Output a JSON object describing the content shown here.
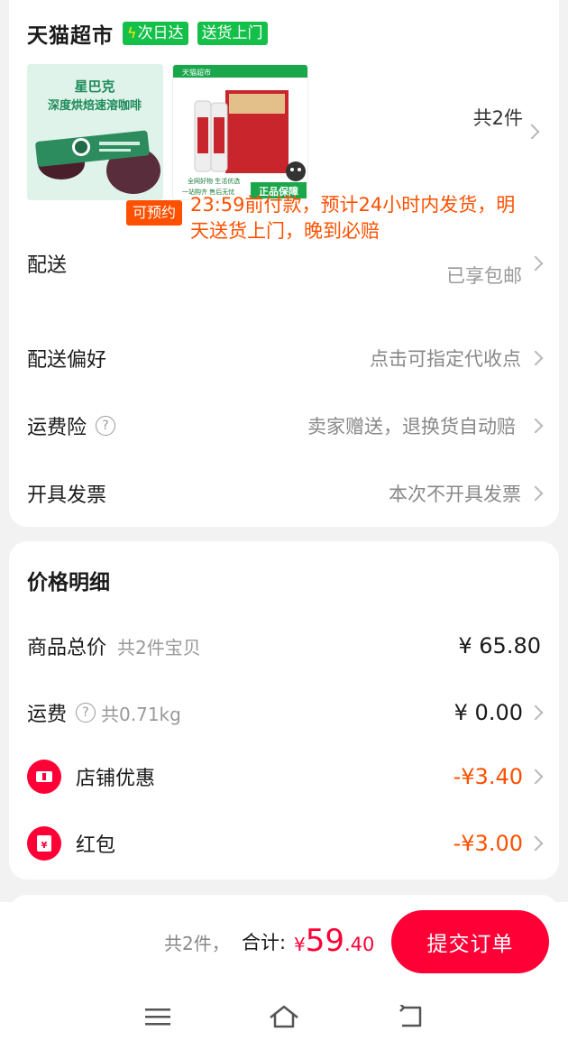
{
  "store": {
    "name": "天猫超市",
    "tag_next_day": "次日达",
    "tag_delivery": "送货上门"
  },
  "products": {
    "item1": {
      "line1": "星巴克",
      "line2": "深度烘焙速溶咖啡"
    },
    "item2": {
      "top_banner": "天猫超市",
      "bottom_left": "全网好物 生活优选",
      "bottom_left2": "一站购齐 售后无忧",
      "badge": "正品保障"
    },
    "count_label": "共2件"
  },
  "delivery": {
    "label": "配送",
    "badge": "可预约",
    "info": "23:59前付款，预计24小时内发货，明天送货上门，晚到必赔",
    "free_shipping": "已享包邮"
  },
  "delivery_pref": {
    "label": "配送偏好",
    "value": "点击可指定代收点"
  },
  "shipping_insurance": {
    "label": "运费险",
    "value": "卖家赠送，退换货自动赔"
  },
  "invoice": {
    "label": "开具发票",
    "value": "本次不开具发票"
  },
  "price_detail": {
    "title": "价格明细",
    "goods_total": {
      "label": "商品总价",
      "sub": "共2件宝贝",
      "value": "¥ 65.80"
    },
    "freight": {
      "label": "运费",
      "sub": "共0.71kg",
      "value": "¥ 0.00"
    },
    "store_discount": {
      "label": "店铺优惠",
      "value": "-¥3.40"
    },
    "red_packet": {
      "label": "红包",
      "value": "-¥3.00"
    }
  },
  "summary": {
    "count": "共2件，",
    "total_label": "合计:",
    "currency": "¥",
    "total_int": "59",
    "total_dec": ".40",
    "submit": "提交订单"
  },
  "colors": {
    "accent": "#ff0036",
    "orange": "#ff5000",
    "green": "#15c04a"
  }
}
